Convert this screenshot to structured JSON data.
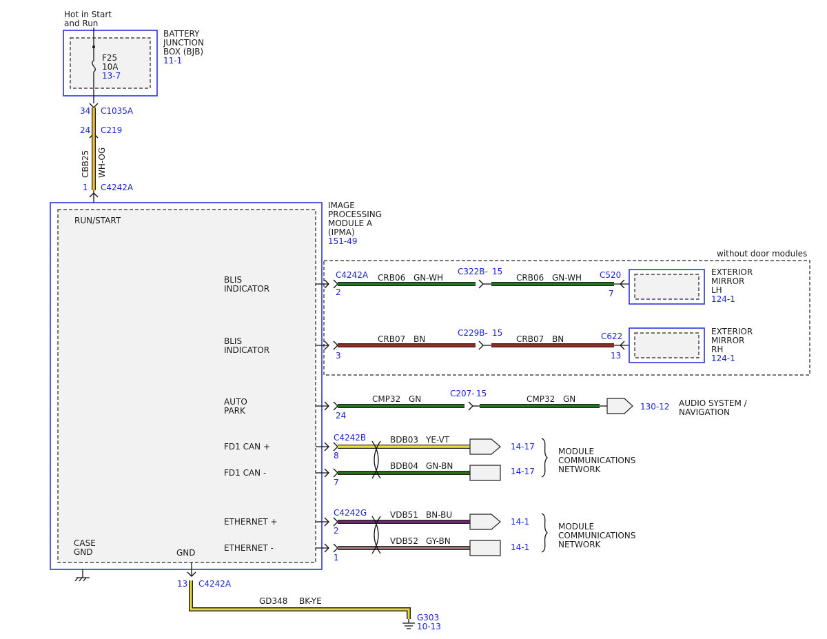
{
  "fuse_supply": {
    "title_line1": "Hot in Start",
    "title_line2": "and Run"
  },
  "bjb": {
    "name_line1": "BATTERY",
    "name_line2": "JUNCTION",
    "name_line3": "BOX (BJB)",
    "ref": "11-1",
    "fuse_name": "F25",
    "fuse_rating": "10A",
    "fuse_ref": "13-7"
  },
  "feed": {
    "c1035a_pin": "34",
    "c1035a": "C1035A",
    "c219_pin": "24",
    "c219": "C219",
    "circuit": "CBB25",
    "color": "WH-OG",
    "c4242a_pin": "1",
    "c4242a": "C4242A",
    "wire_color": "#f2c232"
  },
  "ipma": {
    "name_line1": "IMAGE",
    "name_line2": "PROCESSING",
    "name_line3": "MODULE A",
    "name_line4": "(IPMA)",
    "ref": "151-49",
    "run_start": "RUN/START",
    "case_gnd_line1": "CASE",
    "case_gnd_line2": "GND",
    "gnd": "GND"
  },
  "door_group_label": "without door modules",
  "blis_lh": {
    "label_line1": "BLIS",
    "label_line2": "INDICATOR",
    "conn": "C4242A",
    "pin": "2",
    "circuit1": "CRB06",
    "color1": "GN-WH",
    "inline_conn": "C322B-",
    "inline_pin": "15",
    "circuit2": "CRB06",
    "color2": "GN-WH",
    "end_conn": "C520",
    "end_pin": "7",
    "wire_color": "#1f7a1f",
    "dest_line1": "EXTERIOR",
    "dest_line2": "MIRROR",
    "dest_line3": "LH",
    "dest_ref": "124-1"
  },
  "blis_rh": {
    "label_line1": "BLIS",
    "label_line2": "INDICATOR",
    "pin": "3",
    "circuit1": "CRB07",
    "color1": "BN",
    "inline_conn": "C229B-",
    "inline_pin": "15",
    "circuit2": "CRB07",
    "color2": "BN",
    "end_conn": "C622",
    "end_pin": "13",
    "wire_color": "#9b2a24",
    "dest_line1": "EXTERIOR",
    "dest_line2": "MIRROR",
    "dest_line3": "RH",
    "dest_ref": "124-1"
  },
  "auto_park": {
    "label_line1": "AUTO",
    "label_line2": "PARK",
    "pin": "24",
    "circuit1": "CMP32",
    "color1": "GN",
    "inline_conn": "C207-",
    "inline_pin": "15",
    "circuit2": "CMP32",
    "color2": "GN",
    "dest_ref": "130-12",
    "dest_line1": "AUDIO SYSTEM /",
    "dest_line2": "NAVIGATION",
    "wire_color": "#1f7a1f"
  },
  "can": {
    "conn": "C4242B",
    "plus_label": "FD1 CAN +",
    "plus_pin": "8",
    "plus_circuit": "BDB03",
    "plus_color": "YE-VT",
    "plus_ref": "14-17",
    "minus_label": "FD1 CAN -",
    "minus_pin": "7",
    "minus_circuit": "BDB04",
    "minus_color": "GN-BN",
    "minus_ref": "14-17",
    "network_line1": "MODULE",
    "network_line2": "COMMUNICATIONS",
    "network_line3": "NETWORK",
    "plus_wire": "#f0dc3c",
    "minus_wire": "#2f6d1c"
  },
  "eth": {
    "conn": "C4242G",
    "plus_label": "ETHERNET +",
    "plus_pin": "2",
    "plus_circuit": "VDB51",
    "plus_color": "BN-BU",
    "plus_ref": "14-1",
    "minus_label": "ETHERNET -",
    "minus_pin": "1",
    "minus_circuit": "VDB52",
    "minus_color": "GY-BN",
    "minus_ref": "14-1",
    "network_line1": "MODULE",
    "network_line2": "COMMUNICATIONS",
    "network_line3": "NETWORK",
    "plus_wire": "#6b2a6e",
    "minus_wire": "#9a7a78"
  },
  "ground": {
    "pin": "13",
    "conn": "C4242A",
    "circuit": "GD348",
    "color": "BK-YE",
    "point": "G303",
    "ref": "10-13",
    "wire_color": "#e8dc3a"
  }
}
